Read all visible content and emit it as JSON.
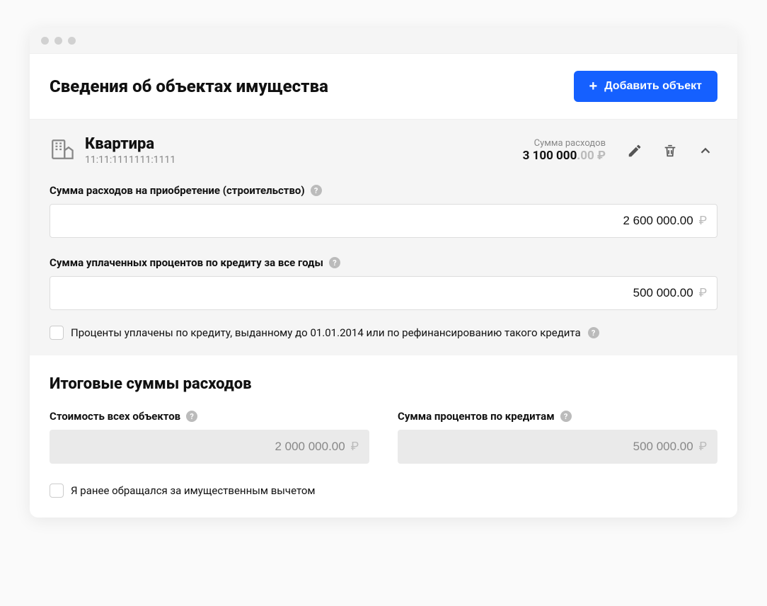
{
  "header": {
    "title": "Сведения об объектах имущества",
    "add_button": "Добавить объект"
  },
  "object": {
    "title": "Квартира",
    "subtitle": "11:11:1111111:1111",
    "sum_label": "Сумма расходов",
    "sum_value_main": "3 100 000",
    "sum_value_dim": ".00 ₽",
    "field1_label": "Сумма расходов на приобретение (строительство)",
    "field1_value": "2 600 000.00",
    "field2_label": "Сумма уплаченных процентов по кредиту за все годы",
    "field2_value": "500 000.00",
    "checkbox_label": "Проценты уплачены по кредиту, выданному до 01.01.2014 или по рефинансированию такого кредита"
  },
  "totals": {
    "title": "Итоговые суммы расходов",
    "col1_label": "Стоимость всех объектов",
    "col1_value": "2 000 000.00",
    "col2_label": "Сумма процентов по кредитам",
    "col2_value": "500 000.00",
    "checkbox_label": "Я ранее обращался за имущественным вычетом"
  },
  "currency": "₽"
}
